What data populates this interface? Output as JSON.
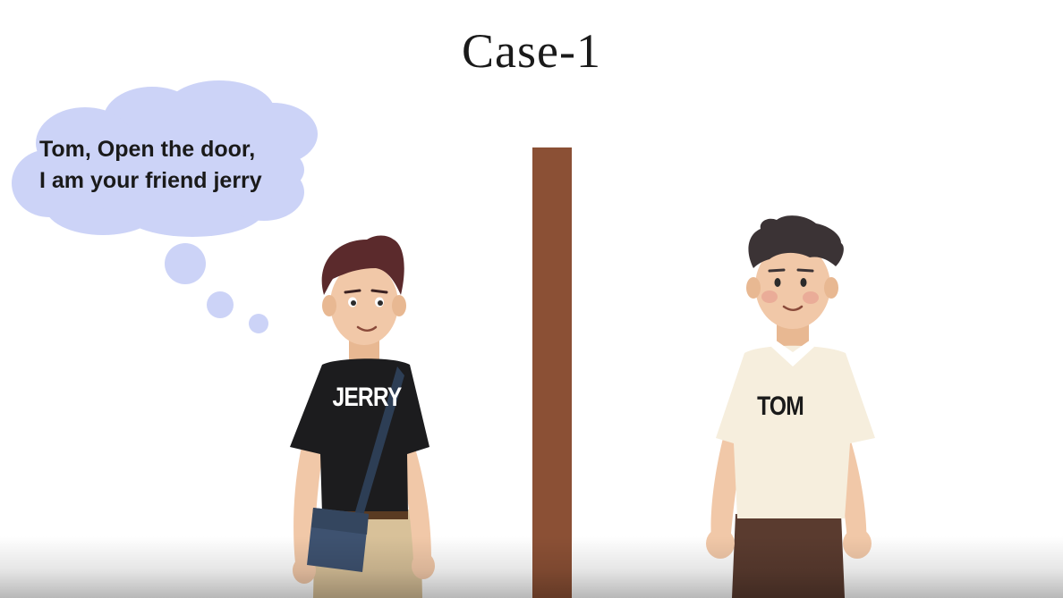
{
  "scene": {
    "title": "Case-1",
    "speech": {
      "line1": "Tom, Open the door,",
      "line2": "I am your friend jerry"
    },
    "characters": {
      "left": {
        "shirt_text": "JERRY"
      },
      "right": {
        "shirt_text": "TOM"
      }
    }
  },
  "colors": {
    "background": "#ffffff",
    "bubble": "#ccd3f7",
    "door": "#8b5035",
    "jerry_shirt": "#1c1c1e",
    "tom_shirt": "#f6eedd"
  }
}
